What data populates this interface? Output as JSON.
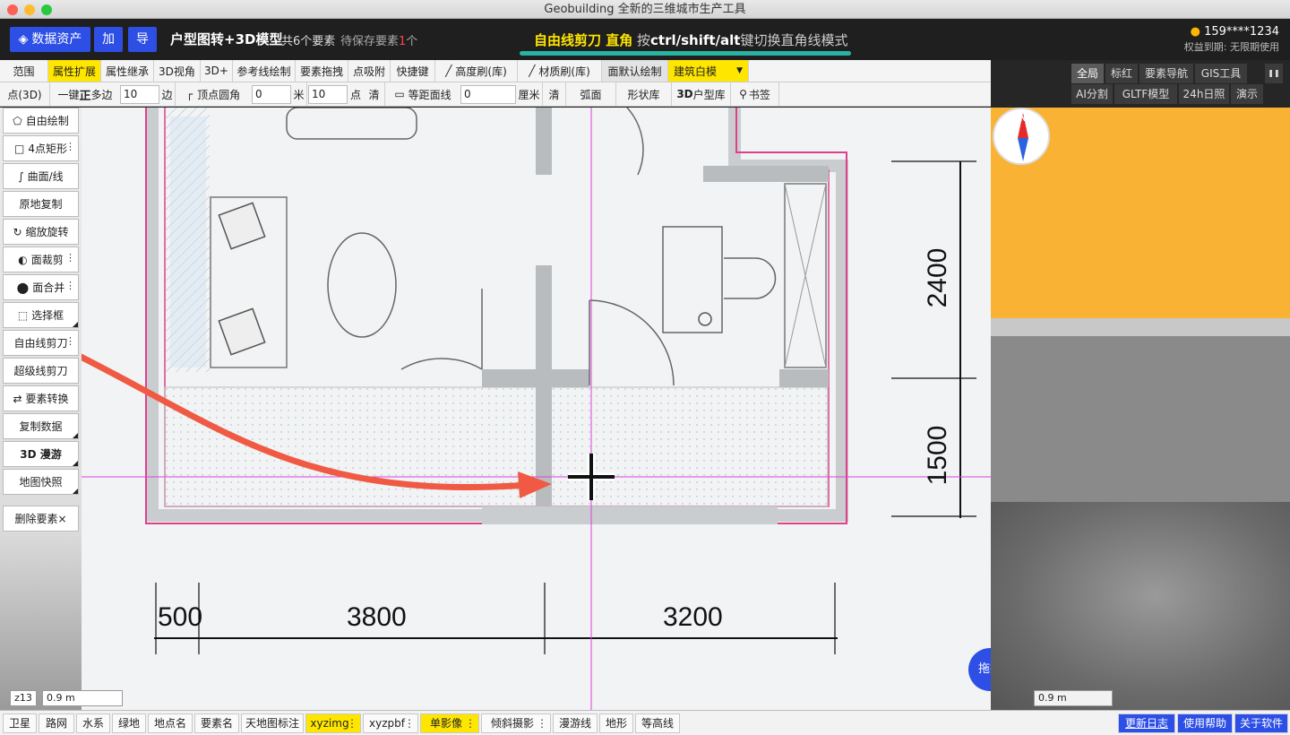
{
  "window": {
    "title": "Geobuilding 全新的三维城市生产工具"
  },
  "header": {
    "assets_label": "数据资产",
    "add_label": "加",
    "import_label": "导",
    "project_title": "户型图转+3D模型",
    "element_count": "共6个要素",
    "pending_prefix": "待保存要素",
    "pending_count": "1",
    "pending_suffix": "个",
    "mode_name": "自由线剪刀 直角",
    "mode_press": "按",
    "mode_keys": "ctrl/shift/alt",
    "mode_hint": "键切换直角线模式",
    "user": "159****1234",
    "expiry": "权益到期: 无限期使用"
  },
  "toolbar1": {
    "items": [
      "范围",
      "属性扩展",
      "属性继承",
      "3D视角",
      "3D+",
      "参考线绘制",
      "要素拖拽",
      "点吸附",
      "快捷键",
      "高度刷(库)",
      "材质刷(库)",
      "面默认绘制"
    ],
    "select_value": "建筑白模"
  },
  "toolbar2": {
    "point3d": "点(3D)",
    "one_key": "一键",
    "zheng": "正",
    "poly": "多边",
    "sides_value": "10",
    "sides_unit": "边",
    "vertex_round": "顶点圆角",
    "round_value": "0",
    "round_unit": "米",
    "round_points": "10",
    "points_unit": "点",
    "clear1": "清",
    "equidistant": "等距面线",
    "equi_value": "0",
    "equi_unit": "厘米",
    "clear2": "清",
    "arc": "弧面",
    "shape_lib": "形状库",
    "threeD": "3D",
    "unit_lib": "户型库",
    "bookmark": "书签"
  },
  "sidebar": {
    "items": [
      "自由绘制",
      "4点矩形",
      "曲面/线",
      "原地复制",
      "缩放旋转",
      "面裁剪",
      "面合并",
      "选择框",
      "自由线剪刀",
      "超级线剪刀",
      "要素转换",
      "复制数据",
      "3D 漫游",
      "地图快照"
    ],
    "delete_label": "删除要素×"
  },
  "map": {
    "dims_vertical": [
      "2400",
      "1500"
    ],
    "dims_horizontal": [
      "500",
      "3800",
      "3200"
    ],
    "zoom": "z13",
    "scale": "0.9 m",
    "drag_label": "拖拽"
  },
  "right_panel": {
    "tabs_row1": [
      "全局",
      "标红",
      "要素导航",
      "GIS工具"
    ],
    "tabs_row2": [
      "AI分割",
      "GLTF模型",
      "24h日照",
      "演示"
    ],
    "compass_label": "N",
    "scale": "0.9 m"
  },
  "bottom": {
    "layers": [
      "卫星",
      "路网",
      "水系",
      "绿地",
      "地点名",
      "要素名",
      "天地图标注",
      "xyzimg",
      "xyzpbf",
      "单影像",
      "倾斜摄影",
      "漫游线",
      "地形",
      "等高线"
    ],
    "links": [
      "更新日志",
      "使用帮助",
      "关于软件"
    ]
  },
  "colors": {
    "accent_blue": "#2d4fe6",
    "highlight_yellow": "#ffe600",
    "teal": "#27b4a2",
    "orange_panel": "#f9b233",
    "annotation_arrow": "#f05a44",
    "wall_outline": "#e0408a"
  }
}
